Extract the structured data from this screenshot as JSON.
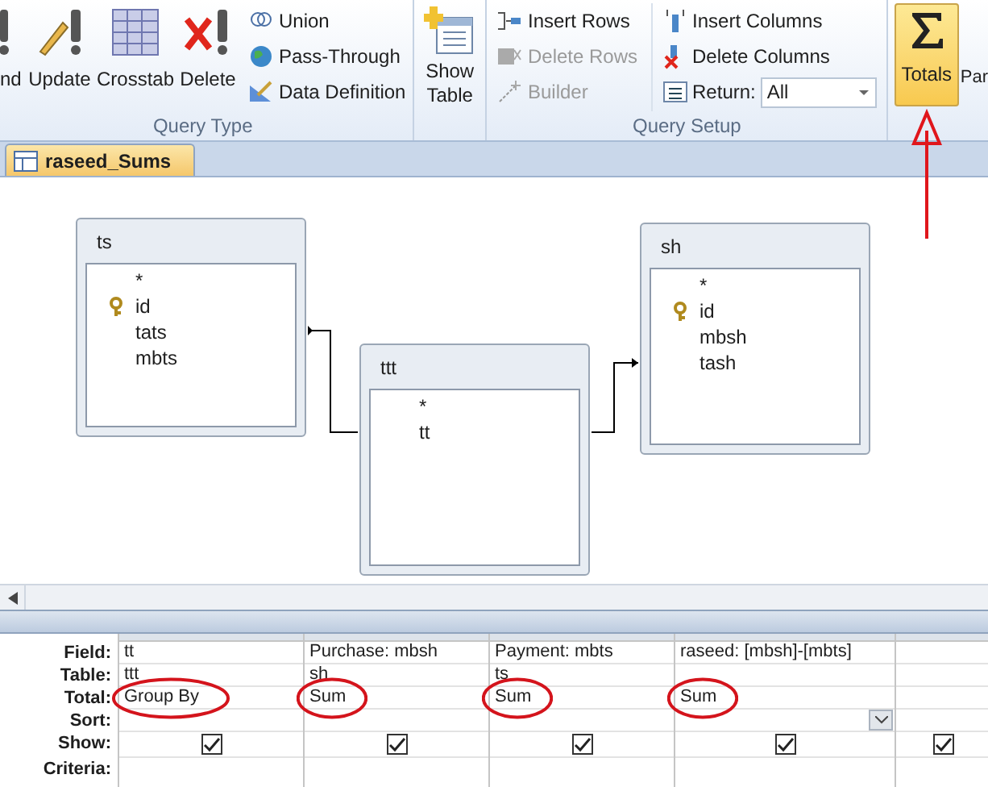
{
  "ribbon": {
    "query_type": {
      "label": "Query Type",
      "large": [
        "nd",
        "Update",
        "Crosstab",
        "Delete"
      ],
      "small": [
        "Union",
        "Pass-Through",
        "Data Definition"
      ]
    },
    "show_table": {
      "label": "Show Table"
    },
    "query_setup": {
      "label": "Query Setup",
      "rows": [
        {
          "label": "Insert Rows",
          "disabled": false
        },
        {
          "label": "Delete Rows",
          "disabled": true
        },
        {
          "label": "Builder",
          "disabled": true
        }
      ],
      "columns": [
        {
          "label": "Insert Columns",
          "disabled": false
        },
        {
          "label": "Delete Columns",
          "disabled": false
        }
      ],
      "return": {
        "label": "Return:",
        "value": "All"
      }
    },
    "totals": {
      "label": "Totals",
      "selected": true
    },
    "cut_button": "Par"
  },
  "document_tab": {
    "title": "raseed_Sums",
    "selected": true
  },
  "tables": [
    {
      "name": "ts",
      "fields": [
        {
          "name": "*",
          "key": false
        },
        {
          "name": "id",
          "key": true
        },
        {
          "name": "tats",
          "key": false
        },
        {
          "name": "mbts",
          "key": false
        }
      ]
    },
    {
      "name": "ttt",
      "fields": [
        {
          "name": "*",
          "key": false
        },
        {
          "name": "tt",
          "key": false
        }
      ]
    },
    {
      "name": "sh",
      "fields": [
        {
          "name": "*",
          "key": false
        },
        {
          "name": "id",
          "key": true
        },
        {
          "name": "mbsh",
          "key": false
        },
        {
          "name": "tash",
          "key": false
        }
      ]
    }
  ],
  "grid": {
    "row_labels": [
      "Field:",
      "Table:",
      "Total:",
      "Sort:",
      "Show:",
      "Criteria:"
    ],
    "columns": [
      {
        "field": "tt",
        "table": "ttt",
        "total": "Group By",
        "show": true,
        "circled": true,
        "focused": false
      },
      {
        "field": "Purchase: mbsh",
        "table": "sh",
        "total": "Sum",
        "show": true,
        "circled": true,
        "focused": false
      },
      {
        "field": "Payment: mbts",
        "table": "ts",
        "total": "Sum",
        "show": true,
        "circled": true,
        "focused": false
      },
      {
        "field": "raseed: [mbsh]-[mbts]",
        "total": "Sum",
        "show": true,
        "circled": true,
        "focused": true
      },
      {
        "show": true,
        "circled": false,
        "focused": false
      }
    ]
  }
}
